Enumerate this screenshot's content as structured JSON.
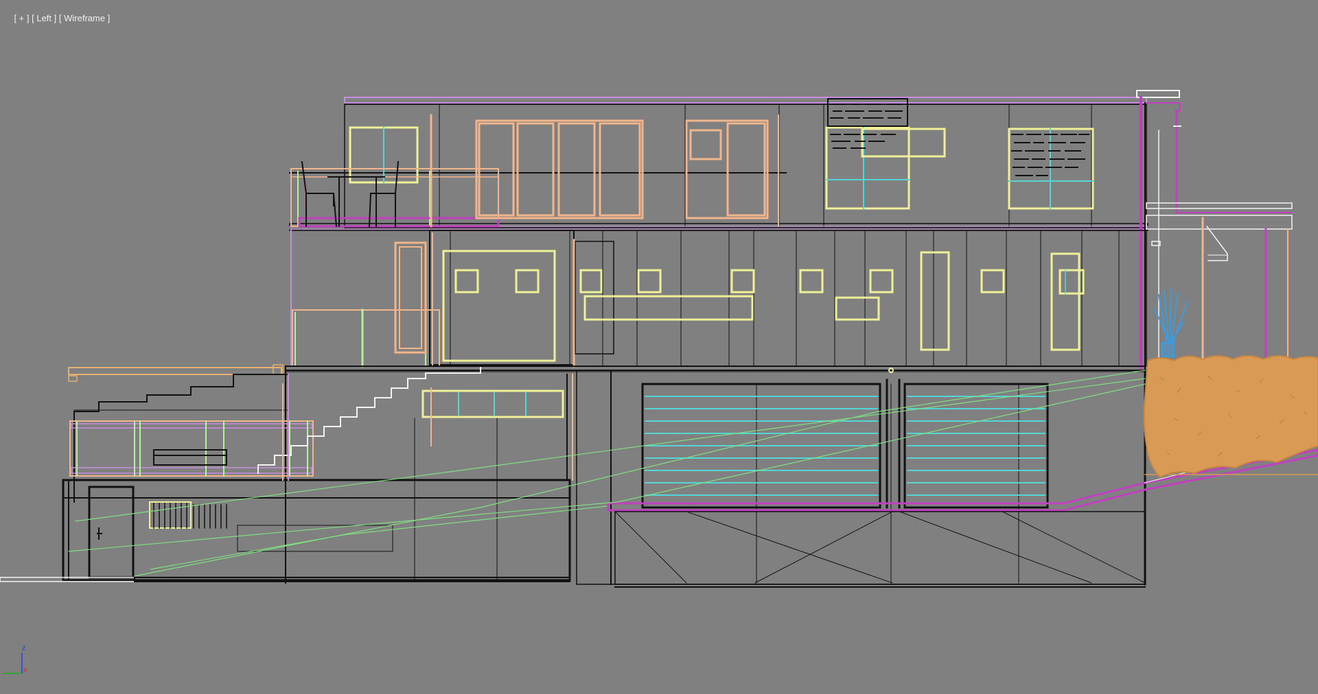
{
  "viewport": {
    "label_parts": [
      "[ + ]",
      "[ Left ]",
      "[ Wireframe ]"
    ],
    "view_name": "Left",
    "shading": "Wireframe"
  },
  "axis": {
    "z_label": "z",
    "x_label": "x",
    "z_color": "#2244dd",
    "x_color": "#dd2222",
    "y_color": "#22aa22"
  },
  "colors": {
    "background": "#808080",
    "wire_dark": "#111111",
    "magenta": "#c040c0",
    "lilac": "#c78de0",
    "window_yellow": "#f0f099",
    "window_orange": "#f2b48a",
    "cyan": "#55d6d6",
    "green": "#7fe07f",
    "light_green": "#b8f0a0",
    "white": "#f4f4f4",
    "hedge": "#d99a55",
    "plant_blue": "#3d9be0"
  },
  "scene": {
    "object_name": "house-elevation-wireframe"
  }
}
